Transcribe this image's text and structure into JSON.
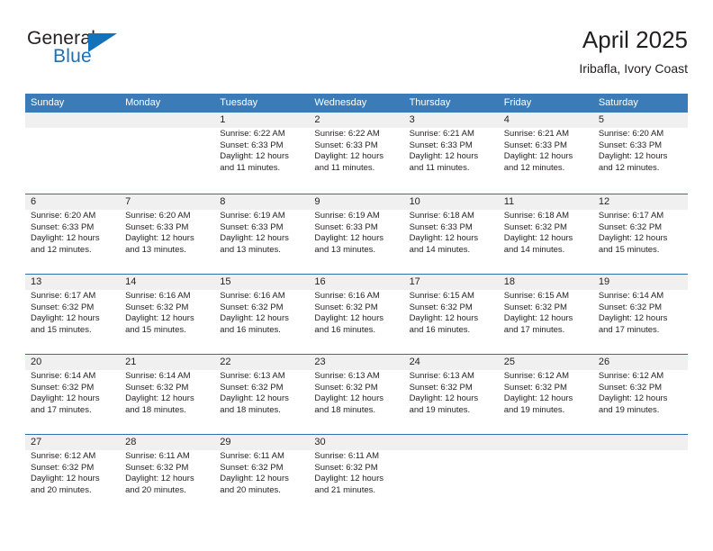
{
  "brand": {
    "name_top": "General",
    "name_bottom": "Blue",
    "accent_color": "#1273ba",
    "text_color": "#231f20"
  },
  "header": {
    "title": "April 2025",
    "subtitle": "Iribafla, Ivory Coast"
  },
  "calendar": {
    "header_bg": "#3b7cb8",
    "row_line_color": "#2f6fab",
    "numband_bg": "#f0f0f0",
    "weekdays": [
      "Sunday",
      "Monday",
      "Tuesday",
      "Wednesday",
      "Thursday",
      "Friday",
      "Saturday"
    ],
    "weeks": [
      [
        {
          "day": "",
          "sunrise": "",
          "sunset": "",
          "daylight1": "",
          "daylight2": ""
        },
        {
          "day": "",
          "sunrise": "",
          "sunset": "",
          "daylight1": "",
          "daylight2": ""
        },
        {
          "day": "1",
          "sunrise": "Sunrise: 6:22 AM",
          "sunset": "Sunset: 6:33 PM",
          "daylight1": "Daylight: 12 hours",
          "daylight2": "and 11 minutes."
        },
        {
          "day": "2",
          "sunrise": "Sunrise: 6:22 AM",
          "sunset": "Sunset: 6:33 PM",
          "daylight1": "Daylight: 12 hours",
          "daylight2": "and 11 minutes."
        },
        {
          "day": "3",
          "sunrise": "Sunrise: 6:21 AM",
          "sunset": "Sunset: 6:33 PM",
          "daylight1": "Daylight: 12 hours",
          "daylight2": "and 11 minutes."
        },
        {
          "day": "4",
          "sunrise": "Sunrise: 6:21 AM",
          "sunset": "Sunset: 6:33 PM",
          "daylight1": "Daylight: 12 hours",
          "daylight2": "and 12 minutes."
        },
        {
          "day": "5",
          "sunrise": "Sunrise: 6:20 AM",
          "sunset": "Sunset: 6:33 PM",
          "daylight1": "Daylight: 12 hours",
          "daylight2": "and 12 minutes."
        }
      ],
      [
        {
          "day": "6",
          "sunrise": "Sunrise: 6:20 AM",
          "sunset": "Sunset: 6:33 PM",
          "daylight1": "Daylight: 12 hours",
          "daylight2": "and 12 minutes."
        },
        {
          "day": "7",
          "sunrise": "Sunrise: 6:20 AM",
          "sunset": "Sunset: 6:33 PM",
          "daylight1": "Daylight: 12 hours",
          "daylight2": "and 13 minutes."
        },
        {
          "day": "8",
          "sunrise": "Sunrise: 6:19 AM",
          "sunset": "Sunset: 6:33 PM",
          "daylight1": "Daylight: 12 hours",
          "daylight2": "and 13 minutes."
        },
        {
          "day": "9",
          "sunrise": "Sunrise: 6:19 AM",
          "sunset": "Sunset: 6:33 PM",
          "daylight1": "Daylight: 12 hours",
          "daylight2": "and 13 minutes."
        },
        {
          "day": "10",
          "sunrise": "Sunrise: 6:18 AM",
          "sunset": "Sunset: 6:33 PM",
          "daylight1": "Daylight: 12 hours",
          "daylight2": "and 14 minutes."
        },
        {
          "day": "11",
          "sunrise": "Sunrise: 6:18 AM",
          "sunset": "Sunset: 6:32 PM",
          "daylight1": "Daylight: 12 hours",
          "daylight2": "and 14 minutes."
        },
        {
          "day": "12",
          "sunrise": "Sunrise: 6:17 AM",
          "sunset": "Sunset: 6:32 PM",
          "daylight1": "Daylight: 12 hours",
          "daylight2": "and 15 minutes."
        }
      ],
      [
        {
          "day": "13",
          "sunrise": "Sunrise: 6:17 AM",
          "sunset": "Sunset: 6:32 PM",
          "daylight1": "Daylight: 12 hours",
          "daylight2": "and 15 minutes."
        },
        {
          "day": "14",
          "sunrise": "Sunrise: 6:16 AM",
          "sunset": "Sunset: 6:32 PM",
          "daylight1": "Daylight: 12 hours",
          "daylight2": "and 15 minutes."
        },
        {
          "day": "15",
          "sunrise": "Sunrise: 6:16 AM",
          "sunset": "Sunset: 6:32 PM",
          "daylight1": "Daylight: 12 hours",
          "daylight2": "and 16 minutes."
        },
        {
          "day": "16",
          "sunrise": "Sunrise: 6:16 AM",
          "sunset": "Sunset: 6:32 PM",
          "daylight1": "Daylight: 12 hours",
          "daylight2": "and 16 minutes."
        },
        {
          "day": "17",
          "sunrise": "Sunrise: 6:15 AM",
          "sunset": "Sunset: 6:32 PM",
          "daylight1": "Daylight: 12 hours",
          "daylight2": "and 16 minutes."
        },
        {
          "day": "18",
          "sunrise": "Sunrise: 6:15 AM",
          "sunset": "Sunset: 6:32 PM",
          "daylight1": "Daylight: 12 hours",
          "daylight2": "and 17 minutes."
        },
        {
          "day": "19",
          "sunrise": "Sunrise: 6:14 AM",
          "sunset": "Sunset: 6:32 PM",
          "daylight1": "Daylight: 12 hours",
          "daylight2": "and 17 minutes."
        }
      ],
      [
        {
          "day": "20",
          "sunrise": "Sunrise: 6:14 AM",
          "sunset": "Sunset: 6:32 PM",
          "daylight1": "Daylight: 12 hours",
          "daylight2": "and 17 minutes."
        },
        {
          "day": "21",
          "sunrise": "Sunrise: 6:14 AM",
          "sunset": "Sunset: 6:32 PM",
          "daylight1": "Daylight: 12 hours",
          "daylight2": "and 18 minutes."
        },
        {
          "day": "22",
          "sunrise": "Sunrise: 6:13 AM",
          "sunset": "Sunset: 6:32 PM",
          "daylight1": "Daylight: 12 hours",
          "daylight2": "and 18 minutes."
        },
        {
          "day": "23",
          "sunrise": "Sunrise: 6:13 AM",
          "sunset": "Sunset: 6:32 PM",
          "daylight1": "Daylight: 12 hours",
          "daylight2": "and 18 minutes."
        },
        {
          "day": "24",
          "sunrise": "Sunrise: 6:13 AM",
          "sunset": "Sunset: 6:32 PM",
          "daylight1": "Daylight: 12 hours",
          "daylight2": "and 19 minutes."
        },
        {
          "day": "25",
          "sunrise": "Sunrise: 6:12 AM",
          "sunset": "Sunset: 6:32 PM",
          "daylight1": "Daylight: 12 hours",
          "daylight2": "and 19 minutes."
        },
        {
          "day": "26",
          "sunrise": "Sunrise: 6:12 AM",
          "sunset": "Sunset: 6:32 PM",
          "daylight1": "Daylight: 12 hours",
          "daylight2": "and 19 minutes."
        }
      ],
      [
        {
          "day": "27",
          "sunrise": "Sunrise: 6:12 AM",
          "sunset": "Sunset: 6:32 PM",
          "daylight1": "Daylight: 12 hours",
          "daylight2": "and 20 minutes."
        },
        {
          "day": "28",
          "sunrise": "Sunrise: 6:11 AM",
          "sunset": "Sunset: 6:32 PM",
          "daylight1": "Daylight: 12 hours",
          "daylight2": "and 20 minutes."
        },
        {
          "day": "29",
          "sunrise": "Sunrise: 6:11 AM",
          "sunset": "Sunset: 6:32 PM",
          "daylight1": "Daylight: 12 hours",
          "daylight2": "and 20 minutes."
        },
        {
          "day": "30",
          "sunrise": "Sunrise: 6:11 AM",
          "sunset": "Sunset: 6:32 PM",
          "daylight1": "Daylight: 12 hours",
          "daylight2": "and 21 minutes."
        },
        {
          "day": "",
          "sunrise": "",
          "sunset": "",
          "daylight1": "",
          "daylight2": ""
        },
        {
          "day": "",
          "sunrise": "",
          "sunset": "",
          "daylight1": "",
          "daylight2": ""
        },
        {
          "day": "",
          "sunrise": "",
          "sunset": "",
          "daylight1": "",
          "daylight2": ""
        }
      ]
    ]
  }
}
